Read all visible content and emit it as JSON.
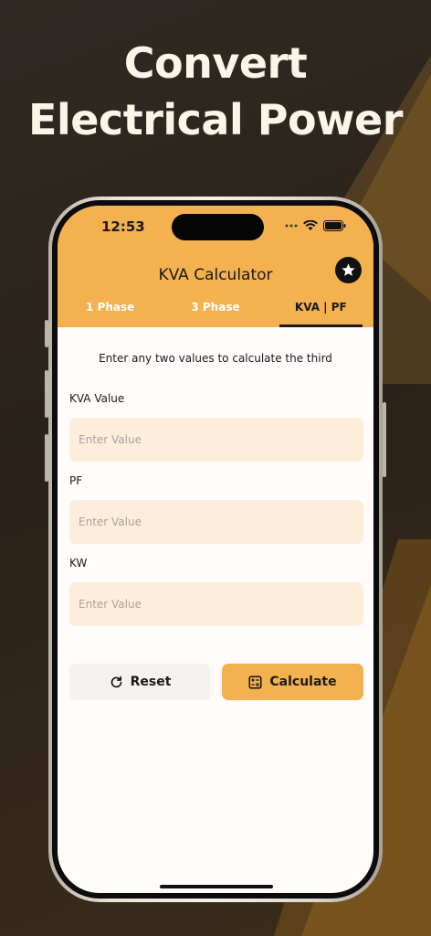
{
  "promo": {
    "line1": "Convert",
    "line2": "Electrical Power"
  },
  "status_bar": {
    "time": "12:53"
  },
  "app": {
    "title": "KVA Calculator",
    "favorite_icon": "star-icon",
    "tabs": [
      {
        "label": "1 Phase",
        "active": false
      },
      {
        "label": "3 Phase",
        "active": false
      },
      {
        "label": "KVA | PF",
        "active": true
      }
    ]
  },
  "form": {
    "instruction": "Enter any two values to calculate the third",
    "fields": [
      {
        "label": "KVA Value",
        "placeholder": "Enter Value",
        "value": ""
      },
      {
        "label": "PF",
        "placeholder": "Enter Value",
        "value": ""
      },
      {
        "label": "KW",
        "placeholder": "Enter Value",
        "value": ""
      }
    ],
    "reset_label": "Reset",
    "reset_icon": "refresh-icon",
    "calculate_label": "Calculate",
    "calculate_icon": "calculator-icon"
  },
  "colors": {
    "accent": "#f4b14f",
    "field_bg": "#fdeedb",
    "background": "#2b241c"
  }
}
